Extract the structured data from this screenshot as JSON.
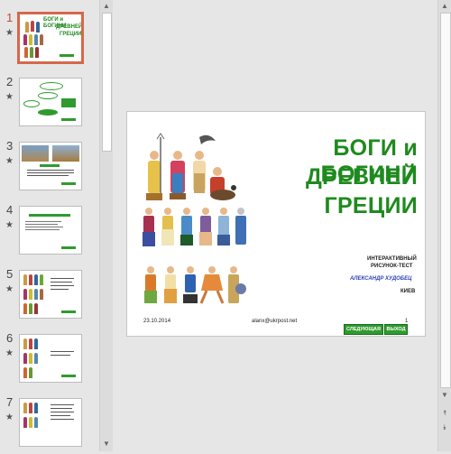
{
  "thumbnails": [
    {
      "num": "1",
      "star": "★",
      "active": true
    },
    {
      "num": "2",
      "star": "★",
      "active": false
    },
    {
      "num": "3",
      "star": "★",
      "active": false
    },
    {
      "num": "4",
      "star": "★",
      "active": false
    },
    {
      "num": "5",
      "star": "★",
      "active": false
    },
    {
      "num": "6",
      "star": "★",
      "active": false
    },
    {
      "num": "7",
      "star": "★",
      "active": false
    }
  ],
  "thumb1_title": [
    "БОГИ и БОГИНИ",
    "ДРЕВНЕЙ",
    "ГРЕЦИИ"
  ],
  "slide": {
    "title_line1": "БОГИ и БОГИНИ",
    "title_line2": "ДРЕВНЕЙ",
    "title_line3": "ГРЕЦИИ",
    "subtitle_line1": "ИНТЕРАКТИВНЫЙ",
    "subtitle_line2": "РИСУНОК-ТЕСТ",
    "author": "АЛЕКСАНДР ХУДОБЕЦ",
    "city": "КИЕВ",
    "date": "23.10.2014",
    "email": "alanx@ukrpost.net",
    "page_number": "1",
    "next_button": "СЛЕДУЮЩАЯ",
    "exit_button": "ВЫХОД"
  },
  "scroll_arrows": {
    "up": "▲",
    "down": "▼",
    "prev_slide": "⯭",
    "next_slide": "⯯"
  },
  "colors": {
    "title_green": "#1e8a1e",
    "author_blue": "#2a3fb8",
    "active_thumb": "#d5684a"
  }
}
